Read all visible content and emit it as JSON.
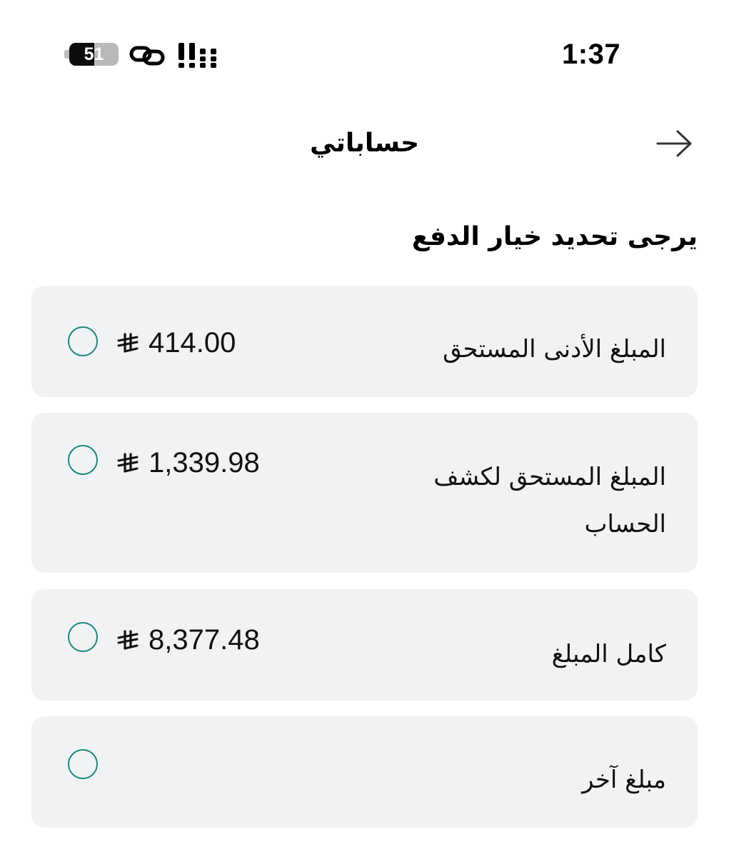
{
  "status_bar": {
    "time": "1:37",
    "battery_level": "51",
    "battery_fraction": 0.51,
    "icons": [
      "battery-icon",
      "link-icon",
      "signal-icon"
    ]
  },
  "header": {
    "title": "حساباتي",
    "back_icon": "arrow-right-icon"
  },
  "section": {
    "title": "يرجى تحديد خيار الدفع"
  },
  "options": [
    {
      "label": "المبلغ الأدنى المستحق",
      "amount": "414.00",
      "selected": false
    },
    {
      "label": "المبلغ المستحق لكشف الحساب",
      "amount": "1,339.98",
      "selected": false
    },
    {
      "label": "كامل المبلغ",
      "amount": "8,377.48",
      "selected": false
    },
    {
      "label": "مبلغ آخر",
      "amount": "",
      "selected": false
    }
  ],
  "colors": {
    "card_background": "#f1f2f4",
    "radio_border": "#1e877f",
    "text": "#111111"
  }
}
